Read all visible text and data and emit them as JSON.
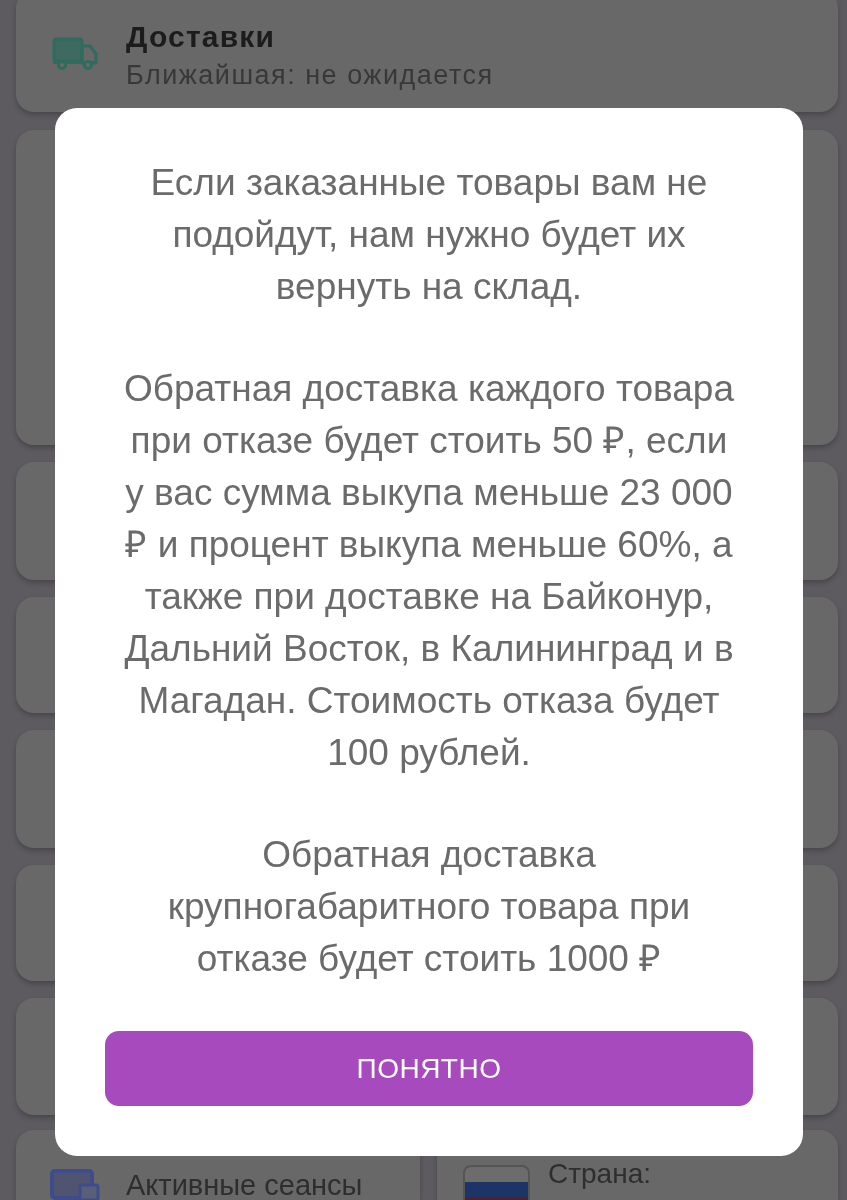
{
  "deliveries_card": {
    "title": "Доставки",
    "subtitle": "Ближайшая: не ожидается"
  },
  "sessions_card": {
    "title": "Активные сеансы"
  },
  "country_card": {
    "label": "Страна:"
  },
  "dialog": {
    "paragraphs": [
      "Если заказанные товары вам не подойдут, нам нужно будет их вернуть на склад.",
      "Обратная доставка каждого товара при отказе будет стоить 50 ₽, если у вас сумма выкупа меньше 23 000 ₽ и процент выкупа меньше 60%, а также при доставке на Байконур, Дальний Восток, в Калининград и в Магадан. Стоимость отказа будет 100 рублей.",
      "Обратная доставка крупногабаритного товара при отказе будет стоить 1000 ₽"
    ],
    "button": "ПОНЯТНО"
  }
}
